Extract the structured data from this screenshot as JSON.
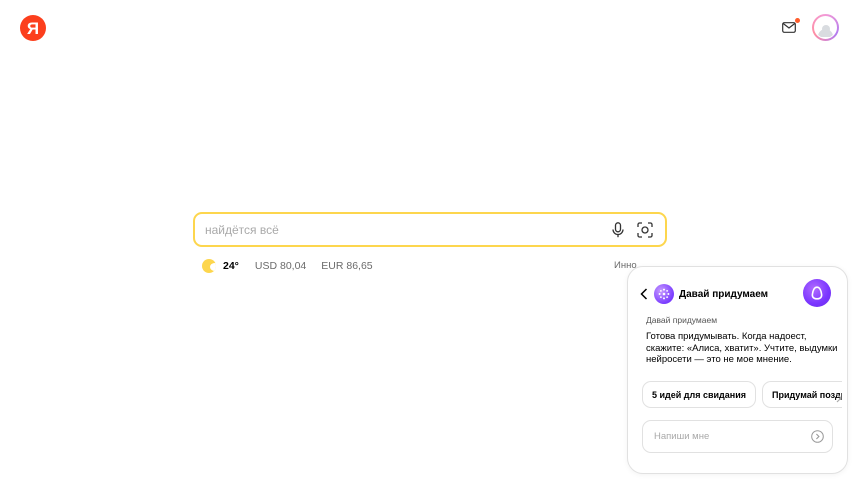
{
  "header": {
    "logo_text": "Я",
    "logo_icon": "yandex-logo-icon",
    "mail_icon": "mail-icon",
    "mail_notification": true,
    "avatar_icon": "user-avatar-icon"
  },
  "search": {
    "placeholder": "найдётся всё",
    "value": "",
    "voice_icon": "microphone-icon",
    "camera_icon": "camera-search-icon"
  },
  "informers": {
    "weather_icon": "weather-sun-icon",
    "temperature": "24°",
    "usd": "USD 80,04",
    "eur": "EUR 86,65",
    "truncated_link": "Инно"
  },
  "alice": {
    "back_icon": "chevron-left-icon",
    "skill_icon": "skill-ideas-icon",
    "title": "Давай придумаем",
    "alice_icon": "alice-orb-icon",
    "sender_label": "Давай придумаем",
    "message": "Готова придумывать. Когда надоест, скажите: «Алиса, хватит». Учтите, выдумки нейросети — это не мое мнение.",
    "chips": [
      {
        "label": "5 идей для свидания"
      },
      {
        "label": "Придумай поздр"
      }
    ],
    "chips_scroll_icon": "chevron-right-icon",
    "input_placeholder": "Напиши мне",
    "send_icon": "send-arrow-icon"
  },
  "colors": {
    "brand_red": "#fc3f1d",
    "search_border": "#fdd64d",
    "alice_purple": "#7a35ff",
    "notification": "#ff5c2b"
  }
}
